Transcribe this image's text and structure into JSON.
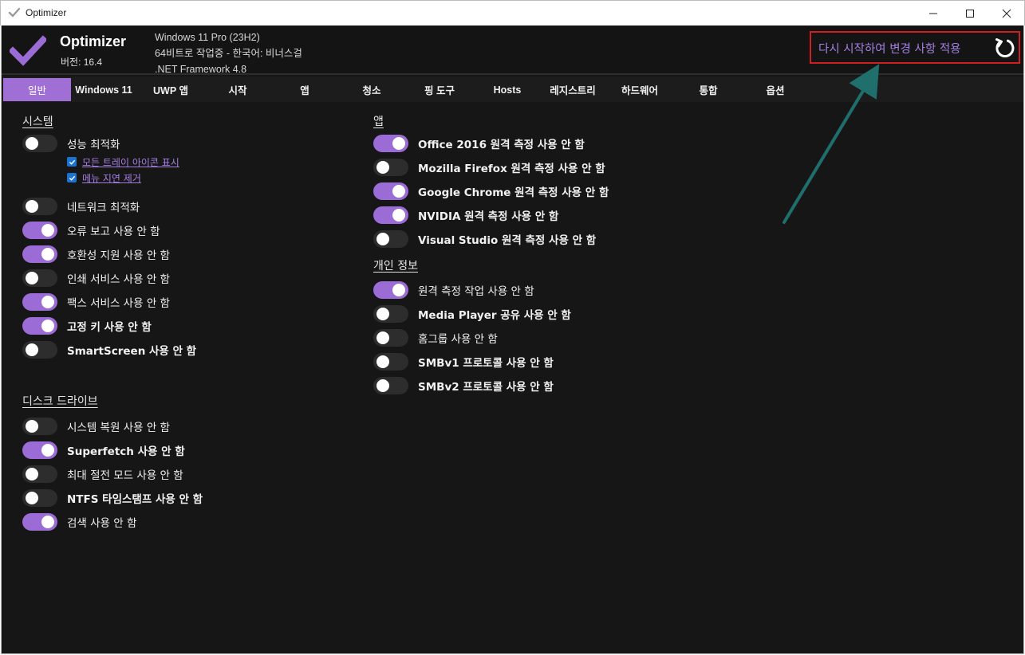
{
  "window": {
    "title": "Optimizer"
  },
  "header": {
    "app_name": "Optimizer",
    "version": "버전: 16.4",
    "sysinfo": [
      "Windows 11 Pro (23H2)",
      "64비트로 작업중 - 한국어: 비너스걸",
      ".NET Framework 4.8"
    ],
    "restart_label": "다시 시작하여 변경 사항 적용",
    "accent_color": "#a06fd6",
    "highlight_color": "#d11f1f"
  },
  "tabs": [
    {
      "label": "일반",
      "active": true
    },
    {
      "label": "Windows 11"
    },
    {
      "label": "UWP 앱"
    },
    {
      "label": "시작"
    },
    {
      "label": "앱"
    },
    {
      "label": "청소"
    },
    {
      "label": "핑 도구"
    },
    {
      "label": "Hosts"
    },
    {
      "label": "레지스트리"
    },
    {
      "label": "하드웨어"
    },
    {
      "label": "통합"
    },
    {
      "label": "옵션"
    }
  ],
  "sections": {
    "system": {
      "title": "시스템",
      "items": [
        {
          "label": "성능 최적화",
          "on": false
        },
        {
          "label": "네트워크 최적화",
          "on": false
        },
        {
          "label": "오류 보고 사용 안 함",
          "on": true
        },
        {
          "label": "호환성 지원 사용 안 함",
          "on": true
        },
        {
          "label": "인쇄 서비스 사용 안 함",
          "on": false
        },
        {
          "label": "팩스 서비스 사용 안 함",
          "on": true
        },
        {
          "label": "고정 키 사용 안 함",
          "on": true
        },
        {
          "label": "SmartScreen 사용 안 함",
          "on": false
        }
      ],
      "sub_options": [
        {
          "label": "모든 트레이 아이콘 표시",
          "checked": true
        },
        {
          "label": "메뉴 지연 제거",
          "checked": true
        }
      ]
    },
    "disk": {
      "title": "디스크 드라이브",
      "items": [
        {
          "label": "시스템 복원 사용 안 함",
          "on": false
        },
        {
          "label": "Superfetch 사용 안 함",
          "on": true
        },
        {
          "label": "최대 절전 모드 사용 안 함",
          "on": false
        },
        {
          "label": "NTFS 타임스탬프 사용 안 함",
          "on": false
        },
        {
          "label": "검색 사용 안 함",
          "on": true
        }
      ]
    },
    "apps": {
      "title": "앱",
      "items": [
        {
          "label": "Office 2016 원격 측정 사용 안 함",
          "on": true
        },
        {
          "label": "Mozilla Firefox 원격 측정 사용 안 함",
          "on": false
        },
        {
          "label": "Google Chrome 원격 측정 사용 안 함",
          "on": true
        },
        {
          "label": "NVIDIA 원격 측정 사용 안 함",
          "on": true
        },
        {
          "label": "Visual Studio 원격 측정 사용 안 함",
          "on": false
        }
      ]
    },
    "privacy": {
      "title": "개인 정보",
      "items": [
        {
          "label": "원격 측정 작업 사용 안 함",
          "on": true
        },
        {
          "label": "Media Player 공유 사용 안 함",
          "on": false
        },
        {
          "label": "홈그룹 사용 안 함",
          "on": false
        },
        {
          "label": "SMBv1 프로토콜 사용 안 함",
          "on": false
        },
        {
          "label": "SMBv2 프로토콜 사용 안 함",
          "on": false
        }
      ]
    }
  }
}
